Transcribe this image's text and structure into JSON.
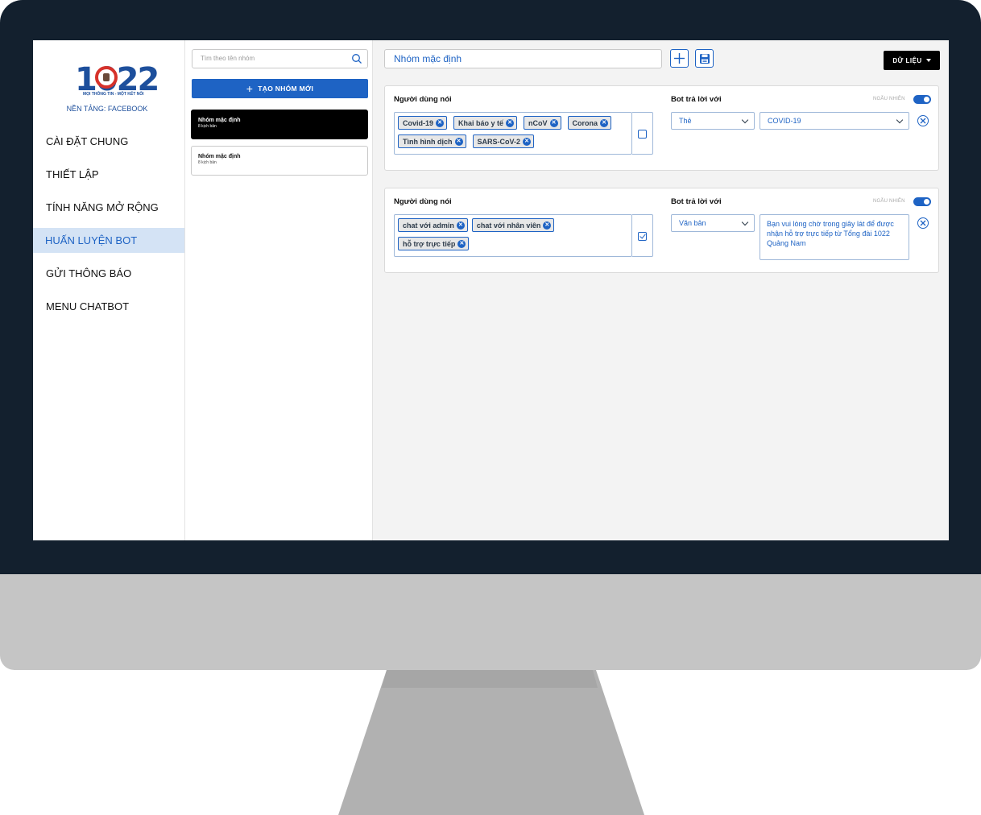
{
  "brand": {
    "logo_text": "1022",
    "slogan": "MỌI THÔNG TIN - MỘT KẾT NỐI",
    "platform": "NỀN TẢNG: FACEBOOK"
  },
  "nav": {
    "items": [
      {
        "label": "CÀI ĐẶT CHUNG"
      },
      {
        "label": "THIẾT LẬP"
      },
      {
        "label": "TÍNH NĂNG MỞ RỘNG"
      },
      {
        "label": "HUẤN LUYỆN BOT"
      },
      {
        "label": "GỬI THÔNG BÁO"
      },
      {
        "label": "MENU CHATBOT"
      }
    ],
    "active": "HUẤN LUYỆN BOT"
  },
  "groups": {
    "search_placeholder": "Tìm theo tên nhóm",
    "new_button": "TẠO NHÓM MỚI",
    "list": [
      {
        "name": "Nhóm mặc định",
        "sub": "8 kịch bản",
        "selected": true
      },
      {
        "name": "Nhóm mặc định",
        "sub": "8 kịch bản",
        "selected": false
      }
    ]
  },
  "main": {
    "group_title": "Nhóm mặc định",
    "data_button": "DỮ LIỆU",
    "rules": [
      {
        "user_says_label": "Người dùng nói",
        "bot_reply_label": "Bot trả lời với",
        "random_label": "NGẪU NHIÊN",
        "random_on": true,
        "tags_row1": [
          "Covid-19",
          "Khai báo y tế",
          "nCoV",
          "Corona"
        ],
        "tags_row2": [
          "Tình hình dịch",
          "SARS-CoV-2"
        ],
        "checked": false,
        "reply_type": "Thẻ",
        "reply_value": "COVID-19"
      },
      {
        "user_says_label": "Người dùng nói",
        "bot_reply_label": "Bot trả lời với",
        "random_label": "NGẪU NHIÊN",
        "random_on": true,
        "tags_row1": [
          "chat với admin",
          "chat với nhân viên"
        ],
        "tags_row2": [
          "hỗ trợ trực tiếp"
        ],
        "checked": true,
        "reply_type": "Văn bản",
        "reply_value": "Bạn vui lòng chờ trong giây lát để được nhận hỗ trợ trực tiếp từ Tổng đài 1022 Quảng Nam"
      }
    ]
  },
  "colors": {
    "accent": "#1e63c4",
    "bezel": "#13202e",
    "active_nav_bg": "#d4e3f5"
  }
}
